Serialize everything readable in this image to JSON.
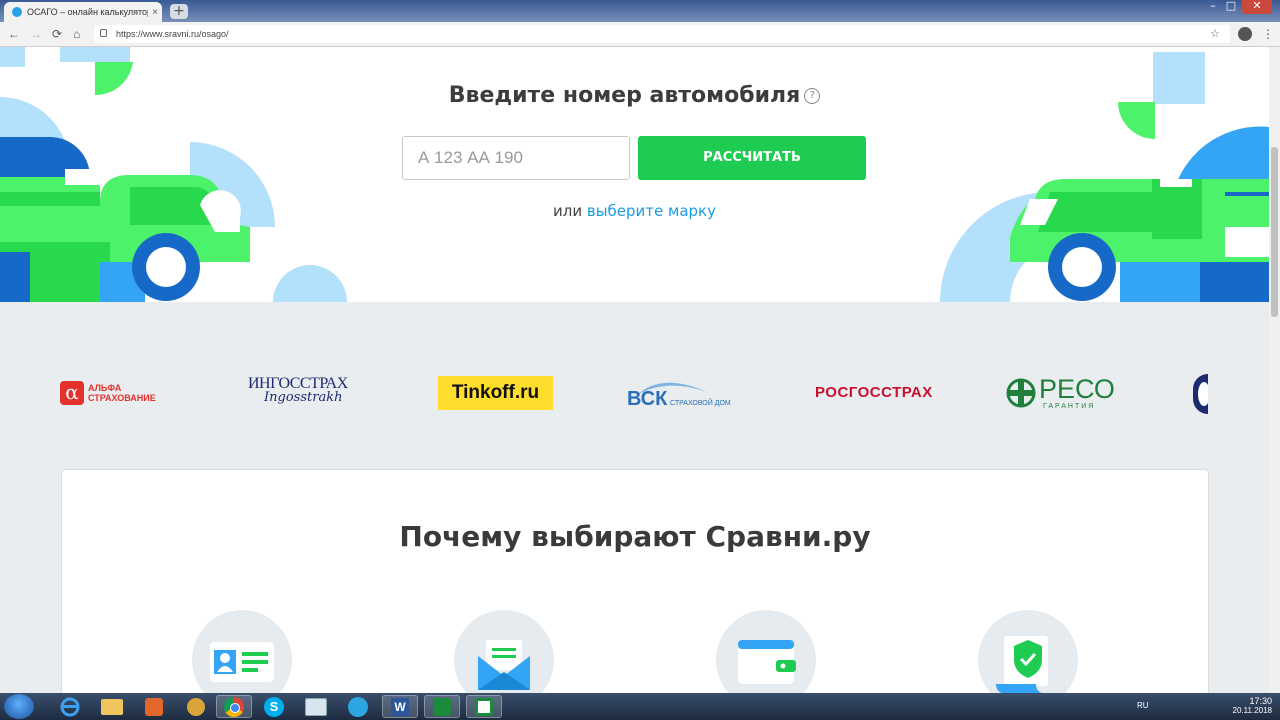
{
  "browser": {
    "tab_title": "ОСАГО – онлайн калькулятор О",
    "tab_close": "×",
    "new_tab": "+",
    "url": "https://www.sravni.ru/osago/",
    "nav": {
      "back": "←",
      "forward": "→",
      "reload": "⟳",
      "home": "⌂",
      "star": "☆",
      "menu": "⋮"
    },
    "window": {
      "minimize": "–",
      "maximize": "□",
      "close": "✕"
    }
  },
  "hero": {
    "title": "Введите номер автомобиля",
    "help_icon": "?",
    "plate_placeholder": "А 123 АА 190",
    "calc_button": "РАССЧИТАТЬ",
    "or_text": "или ",
    "choose_brand_link": "выберите марку"
  },
  "insurers": {
    "alfa": {
      "symbol": "α",
      "line1": "АЛЬФА",
      "line2": "СТРАХОВАНИЕ",
      "color": "#e4312b"
    },
    "ingos": {
      "line1": "ИНГОССТРАХ",
      "line2": "Ingosstrakh",
      "color": "#1d2a70"
    },
    "tinkoff": {
      "name": "Tinkoff",
      "suffix": ".ru",
      "color": "#ffdd2d"
    },
    "vsk": {
      "name": "ВСК",
      "sub": "СТРАХОВОЙ ДОМ",
      "color": "#2c6fb7"
    },
    "rgs": {
      "name": "РОСГОССТРАХ",
      "color": "#c8102e"
    },
    "reso": {
      "name": "РЕСО",
      "sub": "ГАРАНТИЯ",
      "color": "#1f7f3b"
    }
  },
  "why": {
    "title": "Почему выбирают Сравни.ру",
    "features": [
      "id-card-icon",
      "envelope-icon",
      "wallet-icon",
      "shield-document-icon"
    ]
  },
  "taskbar": {
    "lang": "RU",
    "time": "17:30",
    "date": "20.11.2018"
  },
  "colors": {
    "accent_green": "#1fcc52",
    "link_blue": "#1a9be4",
    "page_bg": "#e9edf0"
  }
}
